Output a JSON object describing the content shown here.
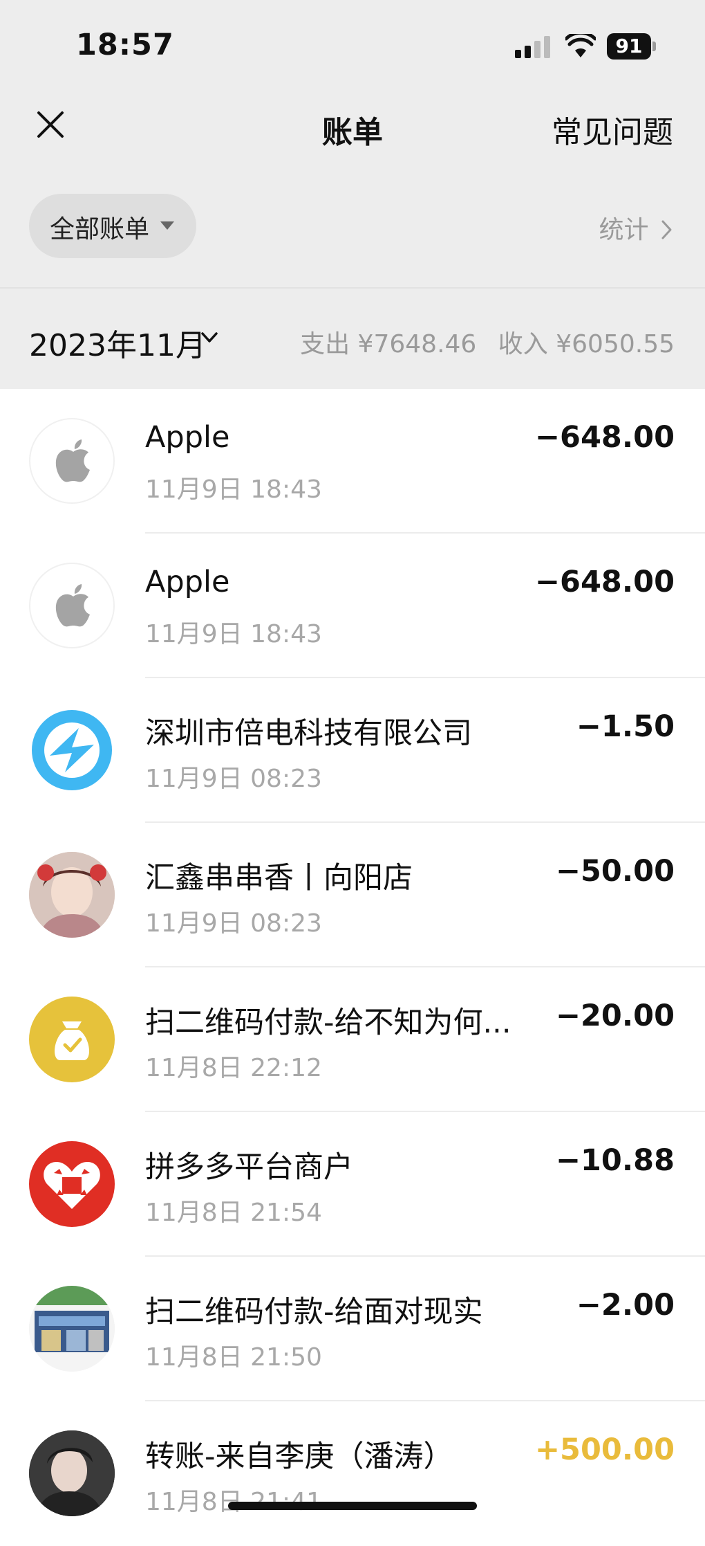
{
  "status_bar": {
    "time": "18:57",
    "battery": "91"
  },
  "nav": {
    "title": "账单",
    "faq": "常见问题"
  },
  "filter": {
    "label": "全部账单",
    "stats_label": "统计"
  },
  "month": {
    "label": "2023年11月",
    "expense": "支出 ¥7648.46",
    "income": "收入 ¥6050.55"
  },
  "colors": {
    "income": "#e9bb3b",
    "background_top": "#ededed"
  },
  "transactions": [
    {
      "name": "Apple",
      "date": "11月9日 18:43",
      "amount": "−648.00",
      "icon": "apple-icon"
    },
    {
      "name": "Apple",
      "date": "11月9日 18:43",
      "amount": "−648.00",
      "icon": "apple-icon"
    },
    {
      "name": "深圳市倍电科技有限公司",
      "date": "11月9日 08:23",
      "amount": "−1.50",
      "icon": "beidian-logo-icon"
    },
    {
      "name": "汇鑫串串香丨向阳店",
      "date": "11月9日 08:23",
      "amount": "−50.00",
      "icon": "person-avatar"
    },
    {
      "name": "扫二维码付款-给不知为何...",
      "date": "11月8日 22:12",
      "amount": "−20.00",
      "icon": "money-bag-icon"
    },
    {
      "name": "拼多多平台商户",
      "date": "11月8日 21:54",
      "amount": "−10.88",
      "icon": "pinduoduo-logo-icon"
    },
    {
      "name": "扫二维码付款-给面对现实",
      "date": "11月8日 21:50",
      "amount": "−2.00",
      "icon": "storefront-avatar"
    },
    {
      "name": "转账-来自李庚（潘涛）",
      "date": "11月8日 21:41",
      "amount": "+500.00",
      "icon": "person-avatar"
    }
  ]
}
